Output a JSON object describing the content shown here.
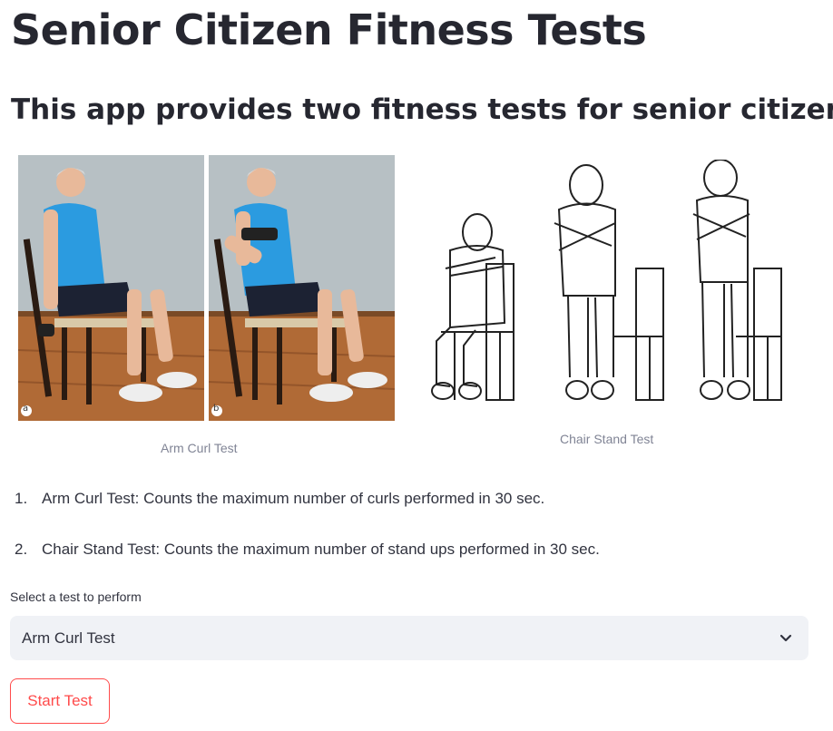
{
  "page": {
    "title": "Senior Citizen Fitness Tests",
    "subtitle": "This app provides two fitness tests for senior citizens:"
  },
  "figures": [
    {
      "caption": "Arm Curl Test",
      "panel_labels": [
        "a",
        "b"
      ]
    },
    {
      "caption": "Chair Stand Test"
    }
  ],
  "instructions": [
    {
      "num": "1.",
      "text": "Arm Curl Test: Counts the maximum number of curls performed in 30 sec."
    },
    {
      "num": "2.",
      "text": "Chair Stand Test: Counts the maximum number of stand ups performed in 30 sec."
    }
  ],
  "test_select": {
    "label": "Select a test to perform",
    "selected": "Arm Curl Test"
  },
  "start_button": {
    "label": "Start Test"
  },
  "colors": {
    "accent": "#ff4b4b",
    "select_bg": "#f0f2f6",
    "text": "#31333f",
    "caption": "#808495"
  },
  "icons": {
    "select_caret": "chevron-down-icon"
  }
}
